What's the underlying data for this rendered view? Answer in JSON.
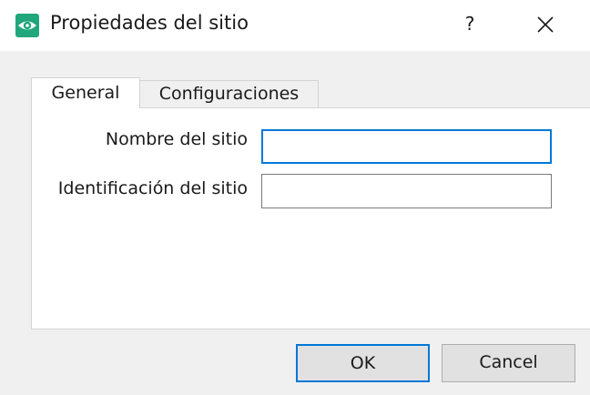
{
  "window": {
    "title": "Propiedades del sitio",
    "help_label": "?",
    "icon": "eye-icon",
    "close_icon": "close-icon",
    "accent_color": "#0078d7",
    "icon_color": "#1fa67a"
  },
  "tabs": [
    {
      "label": "General",
      "selected": true
    },
    {
      "label": "Configuraciones",
      "selected": false
    }
  ],
  "form": {
    "site_name": {
      "label": "Nombre del sitio",
      "value": ""
    },
    "site_id": {
      "label": "Identificación del sitio",
      "value": ""
    }
  },
  "buttons": {
    "ok_label": "OK",
    "cancel_label": "Cancel"
  }
}
